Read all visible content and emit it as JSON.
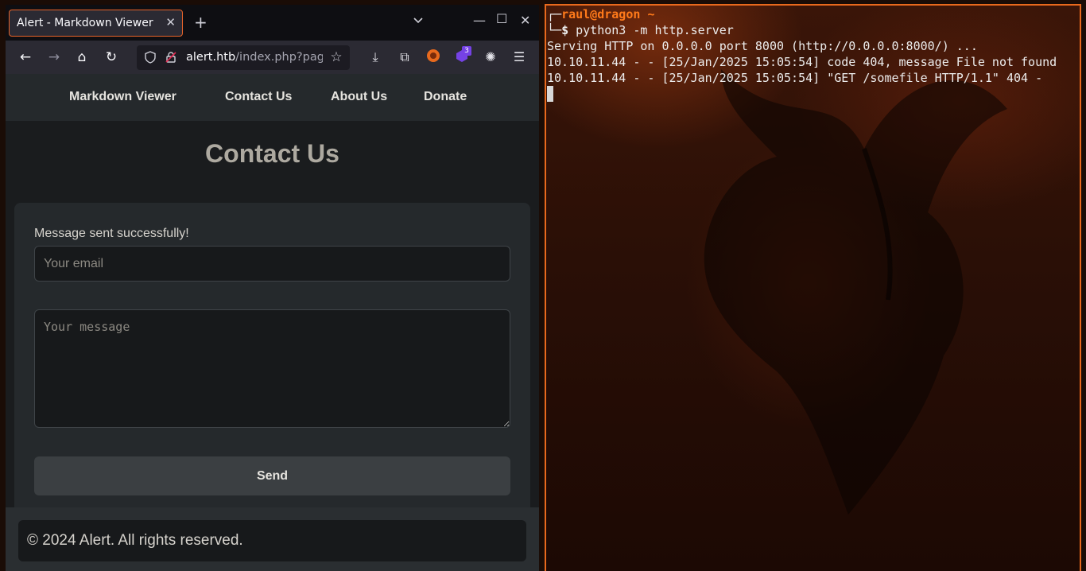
{
  "browser": {
    "tab_title": "Alert - Markdown Viewer",
    "url_domain": "alert.htb",
    "url_path": "/index.php?page=contact",
    "extension_badge": "3"
  },
  "site": {
    "nav": [
      "Markdown Viewer",
      "Contact Us",
      "About Us",
      "Donate"
    ],
    "title": "Contact Us",
    "status_message": "Message sent successfully!",
    "email_placeholder": "Your email",
    "message_placeholder": "Your message",
    "send_label": "Send",
    "footer": "© 2024 Alert. All rights reserved."
  },
  "terminal": {
    "prompt_user": "raul@dragon",
    "prompt_dir": "~",
    "command": "python3 -m http.server",
    "output": [
      "Serving HTTP on 0.0.0.0 port 8000 (http://0.0.0.0:8000/) ...",
      "10.10.11.44 - - [25/Jan/2025 15:05:54] code 404, message File not found",
      "10.10.11.44 - - [25/Jan/2025 15:05:54] \"GET /somefile HTTP/1.1\" 404 -"
    ]
  },
  "colors": {
    "accent_orange": "#e8691d",
    "browser_chrome": "#2b2a33",
    "page_bg": "#1a1c1e"
  }
}
